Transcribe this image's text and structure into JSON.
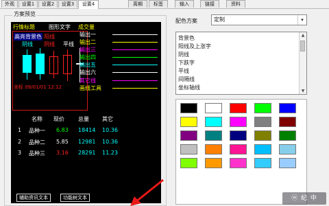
{
  "tabs": [
    {
      "label": "外观",
      "active": false
    },
    {
      "label": "设置1",
      "active": false
    },
    {
      "label": "设置2",
      "active": false
    },
    {
      "label": "设置3",
      "active": false
    },
    {
      "label": "设置4",
      "active": true
    },
    {
      "label": "周期",
      "active": false
    },
    {
      "label": "标签",
      "active": false
    },
    {
      "label": "输入",
      "active": false
    },
    {
      "label": "链接",
      "active": false
    },
    {
      "label": "资料",
      "active": false
    }
  ],
  "preview": {
    "group_label": "方案预览",
    "row1": [
      "行情标题",
      "图形文字",
      "成交量"
    ],
    "row2": [
      "高亮背景色",
      "阳线",
      "平线"
    ],
    "row3": [
      "阴线",
      "阴线"
    ],
    "outputs": [
      "输出一",
      "输出二",
      "输出三",
      "输出四",
      "输出五",
      "输出六"
    ],
    "other_line": "其它线",
    "drawing_tool": "画线工具",
    "axis_text": "坐标 09/01/01 12:12",
    "table_headers": [
      "名称",
      "现价",
      "总量",
      "其它"
    ],
    "rows": [
      {
        "no": "1",
        "name": "品种一",
        "price": "6.83",
        "volume": "18414",
        "other": "10.36"
      },
      {
        "no": "2",
        "name": "品种二",
        "price": "5.85",
        "volume": "12981",
        "other": "10.36"
      },
      {
        "no": "3",
        "name": "品种三",
        "price": "3.16",
        "volume": "28291",
        "other": "11.23"
      }
    ],
    "btn_assist": "辅助资讯文本",
    "btn_func": "功能树文本"
  },
  "scheme": {
    "label": "配色方案",
    "value": "定制",
    "arrow": "▾"
  },
  "items": [
    "背景色",
    "阳线及上涨字",
    "阴线",
    "下跌字",
    "平线",
    "间隔线",
    "坐标轴线"
  ],
  "palette": [
    "#000000",
    "#ffffff",
    "#ff0000",
    "#00ff00",
    "#0000ff",
    "#ffff00",
    "#00ffff",
    "#ff00ff",
    "#808080",
    "#800000",
    "#800080",
    "#008080",
    "#000080",
    "#808000",
    "#008000",
    "#c0c0c0",
    "#ff8000",
    "#ff1493",
    "#00bfff",
    "#87ceeb",
    "#80ff00",
    "#ff9900",
    "#ff33cc",
    "#33ccff",
    "#99ccff"
  ],
  "watermark": "ⓦ 纪 中"
}
